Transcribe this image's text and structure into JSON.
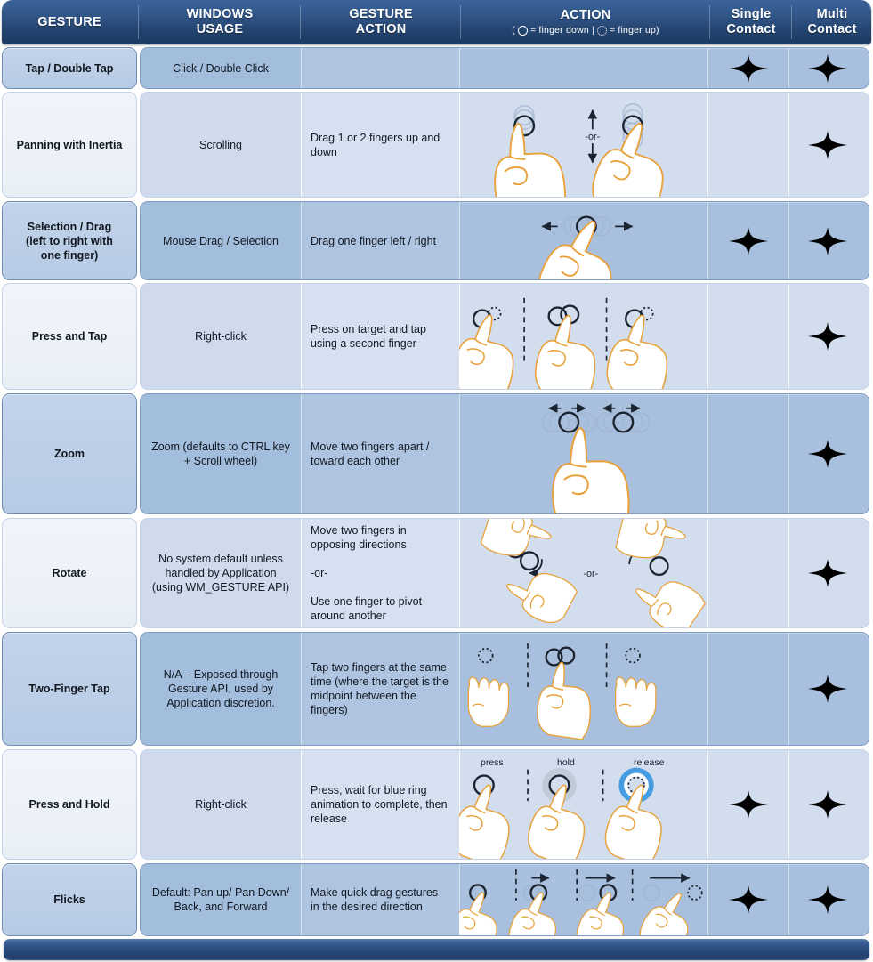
{
  "header": {
    "columns": [
      {
        "title": "GESTURE",
        "sub": ""
      },
      {
        "title": "WINDOWS\nUSAGE",
        "sub": ""
      },
      {
        "title": "GESTURE\nACTION",
        "sub": ""
      },
      {
        "title": "ACTION",
        "sub_prefix": "(",
        "sub_down": "= finger down  |  ",
        "sub_up": "= finger up)"
      },
      {
        "title": "Single\nContact",
        "sub": ""
      },
      {
        "title": "Multi\nContact",
        "sub": ""
      }
    ],
    "gesture_label": "GESTURE",
    "windows_usage_label": "WINDOWS USAGE",
    "gesture_action_label": "GESTURE ACTION",
    "action_label": "ACTION",
    "action_sub_open": "(",
    "action_sub_down": "= finger down  |",
    "action_sub_up": "= finger up)",
    "single_contact_label": "Single Contact",
    "multi_contact_label": "Multi Contact"
  },
  "colors": {
    "header_dark": "#23436e",
    "row_dark": "#a8c0de",
    "row_light": "#d2ddee",
    "star": "#5b7fab",
    "hand_outline": "#e9a23b",
    "ring_dark": "#1b2430",
    "ring_blue": "#2e90e0"
  },
  "rows": [
    {
      "gesture": "Tap / Double Tap",
      "usage": "Click / Double Click",
      "gesture_action": "",
      "action_labels": [],
      "single_contact": true,
      "multi_contact": true,
      "shade": "dark"
    },
    {
      "gesture": "Panning with Inertia",
      "usage": "Scrolling",
      "gesture_action": "Drag 1 or 2 fingers up and down",
      "action_labels": [
        "-or-"
      ],
      "single_contact": false,
      "multi_contact": true,
      "shade": "light"
    },
    {
      "gesture": "Selection / Drag\n(left to right with\none finger)",
      "usage": "Mouse Drag  / Selection",
      "gesture_action": "Drag one finger left / right",
      "action_labels": [],
      "single_contact": true,
      "multi_contact": true,
      "shade": "dark"
    },
    {
      "gesture": "Press and Tap",
      "usage": "Right-click",
      "gesture_action": "Press on target and tap using a second finger",
      "action_labels": [],
      "single_contact": false,
      "multi_contact": true,
      "shade": "light"
    },
    {
      "gesture": "Zoom",
      "usage": "Zoom (defaults to CTRL key + Scroll wheel)",
      "gesture_action": "Move two fingers apart / toward each other",
      "action_labels": [],
      "single_contact": false,
      "multi_contact": true,
      "shade": "dark"
    },
    {
      "gesture": "Rotate",
      "usage": "No system default unless handled by Application (using WM_GESTURE API)",
      "gesture_action": "Move two fingers in opposing directions\n\n-or-\n\nUse one finger to pivot around another",
      "action_labels": [
        "-or-"
      ],
      "single_contact": false,
      "multi_contact": true,
      "shade": "light"
    },
    {
      "gesture": "Two-Finger Tap",
      "usage": "N/A – Exposed through Gesture API, used by Application discretion.",
      "gesture_action": "Tap two fingers at the same time (where the target is the midpoint between the fingers)",
      "action_labels": [],
      "single_contact": false,
      "multi_contact": true,
      "shade": "dark"
    },
    {
      "gesture": "Press and Hold",
      "usage": "Right-click",
      "gesture_action": "Press, wait for blue ring animation to complete, then release",
      "action_labels": [
        "press",
        "hold",
        "release"
      ],
      "single_contact": true,
      "multi_contact": true,
      "shade": "light"
    },
    {
      "gesture": "Flicks",
      "usage": "Default: Pan up/ Pan Down/ Back, and Forward",
      "gesture_action": "Make quick drag gestures in the desired direction",
      "action_labels": [],
      "single_contact": true,
      "multi_contact": true,
      "shade": "dark"
    }
  ]
}
